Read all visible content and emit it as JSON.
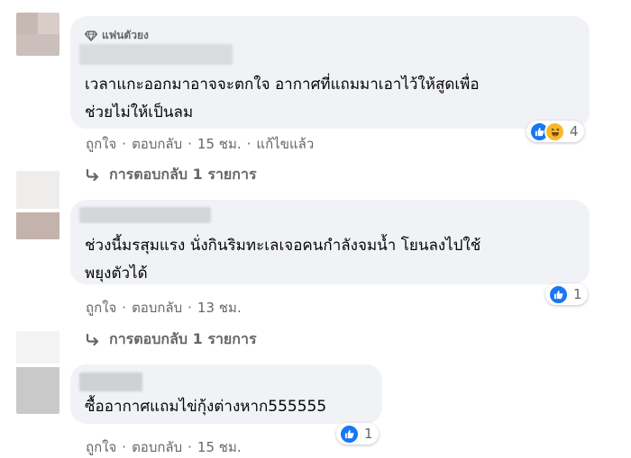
{
  "comments": [
    {
      "badge": "แฟนตัวยง",
      "text_lines": [
        "เวลาแกะออกมาอาจจะตกใจ อากาศที่แถมมาเอาไว้ให้สูดเพื่อ",
        "ช่วยไม่ให้เป็นลม"
      ],
      "like_label": "ถูกใจ",
      "reply_label": "ตอบกลับ",
      "time": "15 ชม.",
      "edited": "แก้ไขแล้ว",
      "reaction_icons": [
        "like-icon",
        "haha-icon"
      ],
      "reaction_count": "4",
      "replies_link": "การตอบกลับ 1 รายการ"
    },
    {
      "text_lines": [
        "ช่วงนี้มรสุมแรง นั่งกินริมทะเลเจอคนกำลังจมน้ำ โยนลงไปใช้",
        "พยุงตัวได้"
      ],
      "like_label": "ถูกใจ",
      "reply_label": "ตอบกลับ",
      "time": "13 ชม.",
      "reaction_icons": [
        "like-icon"
      ],
      "reaction_count": "1",
      "replies_link": "การตอบกลับ 1 รายการ"
    },
    {
      "text_lines": [
        "ซื้ออากาศแถมไข่กุ้งต่างหาก555555"
      ],
      "like_label": "ถูกใจ",
      "reply_label": "ตอบกลับ",
      "time": "15 ชม.",
      "reaction_icons": [
        "like-icon"
      ],
      "reaction_count": "1"
    }
  ],
  "colors": {
    "bubble": "#f0f2f5",
    "meta_text": "#65676b",
    "like_blue": "#1877f2",
    "haha_yellow": "#f7b928"
  }
}
